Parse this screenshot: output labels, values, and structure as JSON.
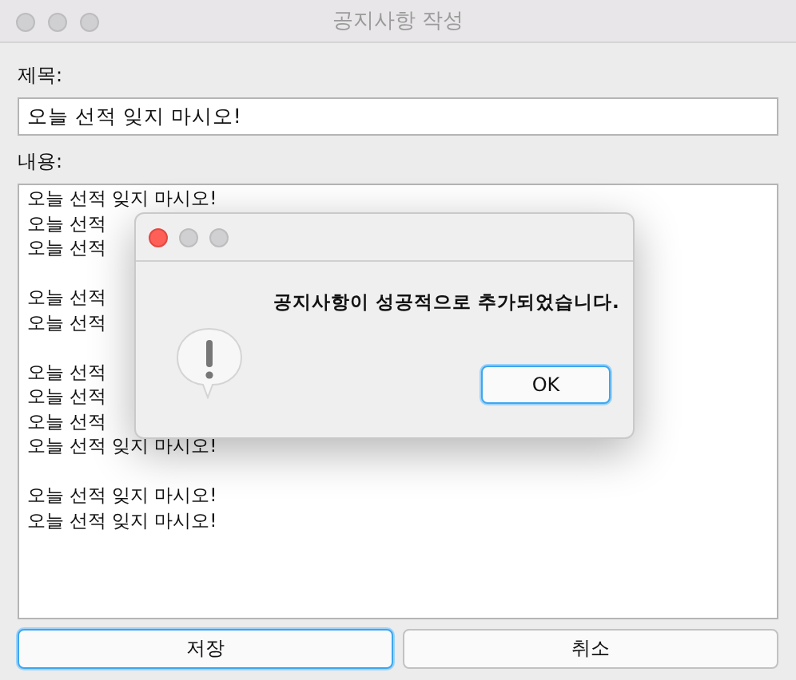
{
  "window": {
    "title": "공지사항 작성"
  },
  "title_field": {
    "label": "제목:",
    "value": "오늘 선적 잊지 마시오!"
  },
  "content_field": {
    "label": "내용:",
    "paragraphs": [
      [
        "오늘 선적 잊지 마시오!",
        "오늘 선적",
        "오늘 선적"
      ],
      [
        "오늘 선적",
        "오늘 선적"
      ],
      [
        "오늘 선적",
        "오늘 선적",
        "오늘 선적",
        "오늘 선적 잊지 마시오!"
      ],
      [
        "오늘 선적 잊지 마시오!",
        "오늘 선적 잊지 마시오!"
      ]
    ]
  },
  "buttons": [
    {
      "label": "저장",
      "focused": true
    },
    {
      "label": "취소",
      "focused": false
    }
  ],
  "dialog": {
    "message": "공지사항이 성공적으로 추가되었습니다.",
    "button": {
      "label": "OK",
      "focused": true
    }
  }
}
